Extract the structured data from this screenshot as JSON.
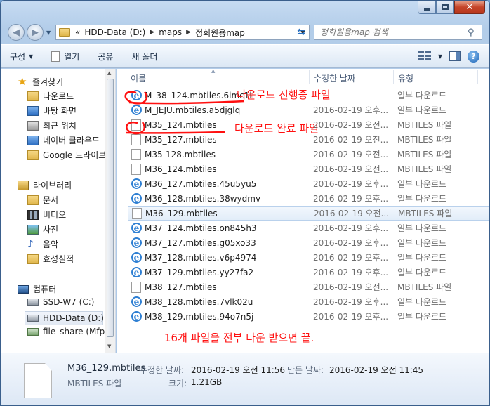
{
  "nav": {
    "breadcrumb": [
      "HDD-Data (D:)",
      "maps",
      "정회원용map"
    ],
    "breadcrumb_prefix": "«",
    "search_placeholder": "정회원용map 검색"
  },
  "toolbar": {
    "organize": "구성",
    "open": "열기",
    "share": "공유",
    "new_folder": "새 폴더"
  },
  "sidebar": {
    "favorites": {
      "label": "즐겨찾기",
      "items": [
        "다운로드",
        "바탕 화면",
        "최근 위치",
        "네이버 클라우드",
        "Google 드라이브"
      ]
    },
    "libraries": {
      "label": "라이브러리",
      "items": [
        "문서",
        "비디오",
        "사진",
        "음악",
        "효성실적"
      ]
    },
    "computer": {
      "label": "컴퓨터",
      "items": [
        "SSD-W7 (C:)",
        "HDD-Data (D:)",
        "file_share (Mfp-C"
      ]
    }
  },
  "columns": {
    "name": "이름",
    "date": "수정한 날짜",
    "type": "유형"
  },
  "files": [
    {
      "name": "M_38_124.mbtiles.6imc1li",
      "date": "",
      "type": "일부 다운로드",
      "icon": "ie-icon"
    },
    {
      "name": "M_JEJU.mbtiles.a5djglq",
      "date": "2016-02-19 오후...",
      "type": "일부 다운로드",
      "icon": "ie-icon"
    },
    {
      "name": "M35_124.mbtiles",
      "date": "2016-02-19 오전...",
      "type": "MBTILES 파일",
      "icon": "file-icon"
    },
    {
      "name": "M35_127.mbtiles",
      "date": "2016-02-19 오전...",
      "type": "MBTILES 파일",
      "icon": "file-icon"
    },
    {
      "name": "M35-128.mbtiles",
      "date": "2016-02-19 오전...",
      "type": "MBTILES 파일",
      "icon": "file-icon"
    },
    {
      "name": "M36_124.mbtiles",
      "date": "2016-02-19 오전...",
      "type": "MBTILES 파일",
      "icon": "file-icon"
    },
    {
      "name": "M36_127.mbtiles.45u5yu5",
      "date": "2016-02-19 오후...",
      "type": "일부 다운로드",
      "icon": "ie-icon"
    },
    {
      "name": "M36_128.mbtiles.38wydmv",
      "date": "2016-02-19 오후...",
      "type": "일부 다운로드",
      "icon": "ie-icon"
    },
    {
      "name": "M36_129.mbtiles",
      "date": "2016-02-19 오전...",
      "type": "MBTILES 파일",
      "icon": "file-icon"
    },
    {
      "name": "M37_124.mbtiles.on845h3",
      "date": "2016-02-19 오후...",
      "type": "일부 다운로드",
      "icon": "ie-icon"
    },
    {
      "name": "M37_127.mbtiles.g05xo33",
      "date": "2016-02-19 오후...",
      "type": "일부 다운로드",
      "icon": "ie-icon"
    },
    {
      "name": "M37_128.mbtiles.v6p4974",
      "date": "2016-02-19 오후...",
      "type": "일부 다운로드",
      "icon": "ie-icon"
    },
    {
      "name": "M37_129.mbtiles.yy27fa2",
      "date": "2016-02-19 오후...",
      "type": "일부 다운로드",
      "icon": "ie-icon"
    },
    {
      "name": "M38_127.mbtiles",
      "date": "2016-02-19 오전...",
      "type": "MBTILES 파일",
      "icon": "file-icon"
    },
    {
      "name": "M38_128.mbtiles.7vlk02u",
      "date": "2016-02-19 오후...",
      "type": "일부 다운로드",
      "icon": "ie-icon"
    },
    {
      "name": "M38_129.mbtiles.94o7n5j",
      "date": "2016-02-19 오후...",
      "type": "일부 다운로드",
      "icon": "ie-icon"
    }
  ],
  "annotations": {
    "downloading": "다운로드 진행중 파일",
    "completed": "다운로드 완료 파일",
    "footer": "16개 파일을 전부 다운 받으면 끝.",
    "color": "#ff1010"
  },
  "details": {
    "name": "M36_129.mbtiles",
    "type": "MBTILES 파일",
    "modified_label": "수정한 날짜:",
    "modified_value": "2016-02-19 오전 11:56",
    "created_label": "만든 날짜:",
    "created_value": "2016-02-19 오전 11:45",
    "size_label": "크기:",
    "size_value": "1.21GB"
  }
}
